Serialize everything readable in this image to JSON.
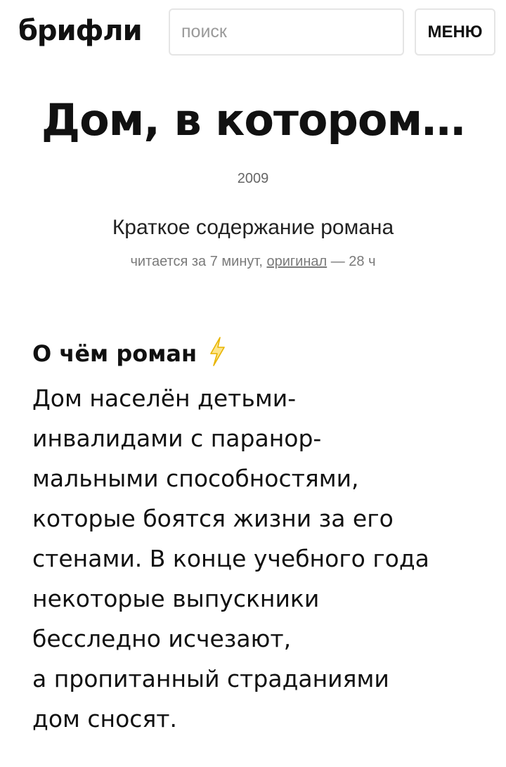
{
  "header": {
    "logo": "брифли",
    "search_placeholder": "поиск",
    "menu_label": "МЕНЮ"
  },
  "book": {
    "title": "Дом, в котором…",
    "year": "2009",
    "subtitle": "Краткое содержание романа",
    "reading_time": "читается за 7 минут,",
    "original_link": "оригинал",
    "original_time": "— 28 ч"
  },
  "section": {
    "title": "О чём роман",
    "icon": "lightning-icon",
    "icon_color": "#f5c518",
    "summary_lines": [
      "Дом населён детьми-",
      "инвалидами с паранор-",
      "мальными способностями,",
      "которые боятся жизни за его",
      "стенами. В конце учебного года",
      "некоторые выпускники",
      "бесследно исчезают,",
      "а пропитанный страданиями",
      "дом сносят."
    ]
  }
}
